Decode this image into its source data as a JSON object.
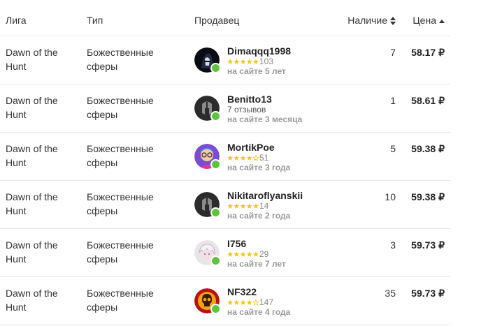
{
  "header": {
    "league": "Лига",
    "type": "Тип",
    "seller": "Продавец",
    "stock": "Наличие",
    "price": "Цена"
  },
  "rows": [
    {
      "league": "Dawn of the\nHunt",
      "type": "Божественные\nсферы",
      "seller": "Dimaqqq1998",
      "stars": 5,
      "rating_count": "103",
      "reviews_text": "",
      "since": "на сайте 5 лет",
      "stock": "7",
      "price": "58.17 ₽",
      "avatar": "dark-hooded-avatar"
    },
    {
      "league": "Dawn of the\nHunt",
      "type": "Божественные\nсферы",
      "seller": "Benitto13",
      "stars": 0,
      "rating_count": "",
      "reviews_text": "7 отзывов",
      "since": "на сайте 3 месяца",
      "stock": "1",
      "price": "58.61 ₽",
      "avatar": "helmet-avatar"
    },
    {
      "league": "Dawn of the\nHunt",
      "type": "Божественные\nсферы",
      "seller": "MortikPoe",
      "stars": 4,
      "rating_count": "51",
      "reviews_text": "",
      "since": "на сайте 3 года",
      "stock": "5",
      "price": "59.38 ₽",
      "avatar": "cartoon-avatar"
    },
    {
      "league": "Dawn of the\nHunt",
      "type": "Божественные\nсферы",
      "seller": "Nikitaroflyanskii",
      "stars": 5,
      "rating_count": "14",
      "reviews_text": "",
      "since": "на сайте 2 года",
      "stock": "10",
      "price": "59.38 ₽",
      "avatar": "helmet-avatar"
    },
    {
      "league": "Dawn of the\nHunt",
      "type": "Божественные\nсферы",
      "seller": "I756",
      "stars": 5,
      "rating_count": "29",
      "reviews_text": "",
      "since": "на сайте 7 лет",
      "stock": "3",
      "price": "59.73 ₽",
      "avatar": "anime-avatar"
    },
    {
      "league": "Dawn of the\nHunt",
      "type": "Божественные\nсферы",
      "seller": "NF322",
      "stars": 4,
      "rating_count": "147",
      "reviews_text": "",
      "since": "на сайте 4 года",
      "stock": "35",
      "price": "59.73 ₽",
      "avatar": "skull-avatar"
    }
  ],
  "colors": {
    "star": "#f5c518",
    "star_empty": "#f5c518",
    "online": "#5cc53c"
  }
}
